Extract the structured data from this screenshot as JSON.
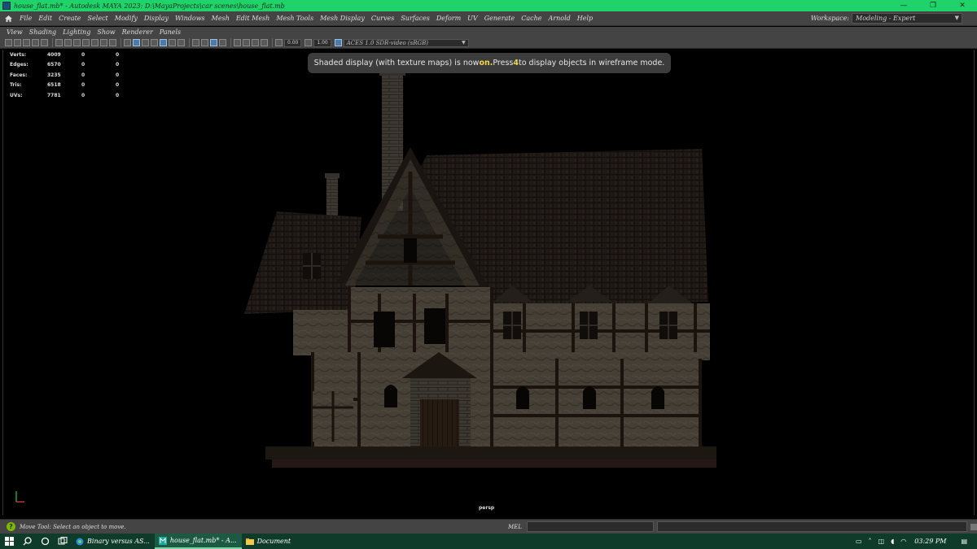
{
  "window": {
    "title": "house_flat.mb* - Autodesk MAYA 2023: D:\\MayaProjects\\car scenes\\house_flat.mb",
    "minimize": "—",
    "restore": "❐",
    "close": "✕"
  },
  "menubar": {
    "items": [
      "File",
      "Edit",
      "Create",
      "Select",
      "Modify",
      "Display",
      "Windows",
      "Mesh",
      "Edit Mesh",
      "Mesh Tools",
      "Mesh Display",
      "Curves",
      "Surfaces",
      "Deform",
      "UV",
      "Generate",
      "Cache",
      "Arnold",
      "Help"
    ],
    "workspace_label": "Workspace:",
    "workspace_value": "Modeling - Expert"
  },
  "panel_menu": [
    "View",
    "Shading",
    "Lighting",
    "Show",
    "Renderer",
    "Panels"
  ],
  "toolbar": {
    "field1": "0.00",
    "field2": "1.00",
    "color_space": "ACES 1.0 SDR-video (sRGB)"
  },
  "hud": {
    "rows": [
      {
        "label": "Verts:",
        "value": "4009",
        "a": "0",
        "b": "0"
      },
      {
        "label": "Edges:",
        "value": "6570",
        "a": "0",
        "b": "0"
      },
      {
        "label": "Faces:",
        "value": "3235",
        "a": "0",
        "b": "0"
      },
      {
        "label": "Tris:",
        "value": "6518",
        "a": "0",
        "b": "0"
      },
      {
        "label": "UVs:",
        "value": "7781",
        "a": "0",
        "b": "0"
      }
    ]
  },
  "toast": {
    "prefix": "Shaded display (with texture maps) is now ",
    "highlight1": "on.",
    "middle": "Press ",
    "highlight2": "4",
    "suffix": " to display objects in wireframe mode."
  },
  "viewport": {
    "camera": "persp"
  },
  "helpline": {
    "message": "Move Tool: Select an object to move.",
    "mel_label": "MEL"
  },
  "taskbar": {
    "tasks": [
      {
        "label": "Binary versus AS...",
        "active": false
      },
      {
        "label": "house_flat.mb* - A...",
        "active": true
      },
      {
        "label": "Document",
        "active": false
      }
    ],
    "clock": "03:29 PM"
  },
  "colors": {
    "titlebar": "#1fd26a",
    "ui_panel": "#444444",
    "viewport_bg": "#000000",
    "toast_highlight": "#f3d64a",
    "taskbar": "#0e3b2a"
  }
}
